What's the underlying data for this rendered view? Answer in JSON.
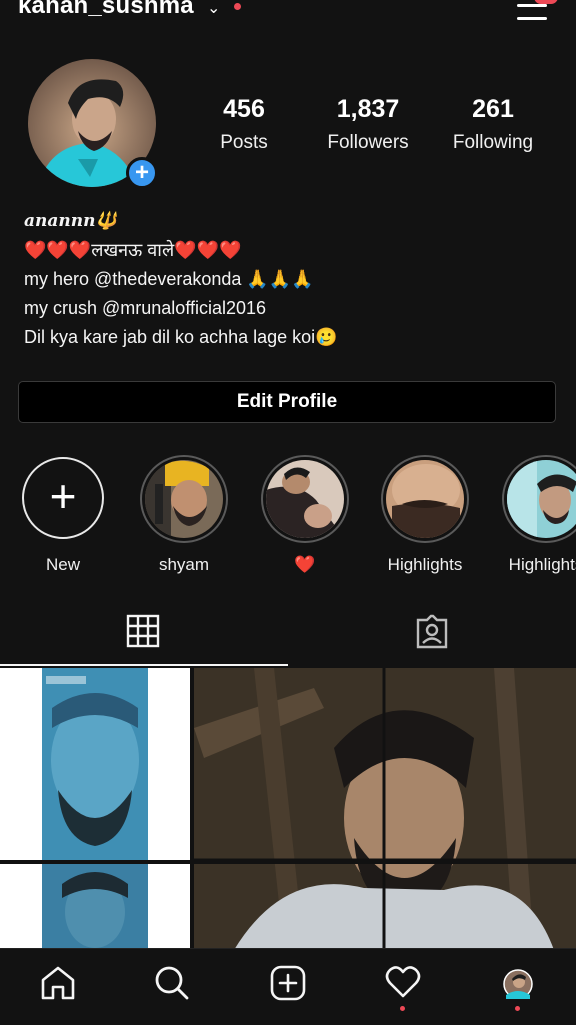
{
  "header": {
    "username": "kanan_sushma",
    "chevron": "chevron-down-icon",
    "menu_icon": "hamburger-menu-icon"
  },
  "profile": {
    "avatar": "profile-avatar",
    "add_icon": "plus-icon",
    "stats": [
      {
        "value": "456",
        "label": "Posts"
      },
      {
        "value": "1,837",
        "label": "Followers"
      },
      {
        "value": "261",
        "label": "Following"
      }
    ],
    "bio": {
      "name": "anannn🔱",
      "line1": "❤️❤️❤️लखनऊ वाले❤️❤️❤️",
      "line2": "my hero @thedeverakonda 🙏🙏🙏",
      "line3": "my crush @mrunalofficial2016",
      "line4": "Dil kya kare jab dil ko achha lage koi🥲"
    },
    "edit_label": "Edit Profile"
  },
  "highlights": [
    {
      "label": "New"
    },
    {
      "label": "shyam"
    },
    {
      "label": "❤️"
    },
    {
      "label": "Highlights"
    },
    {
      "label": "Highlights"
    }
  ],
  "tabs": {
    "grid_icon": "grid-icon",
    "tagged_icon": "tagged-icon"
  },
  "bottom_nav": {
    "home": "home-icon",
    "search": "search-icon",
    "create": "add-post-icon",
    "activity": "heart-icon",
    "profile": "profile-avatar-icon"
  },
  "colors": {
    "background": "#121212",
    "accent_blue": "#3897f0",
    "notification_red": "#ed4956",
    "heart_red": "#e0282e"
  }
}
